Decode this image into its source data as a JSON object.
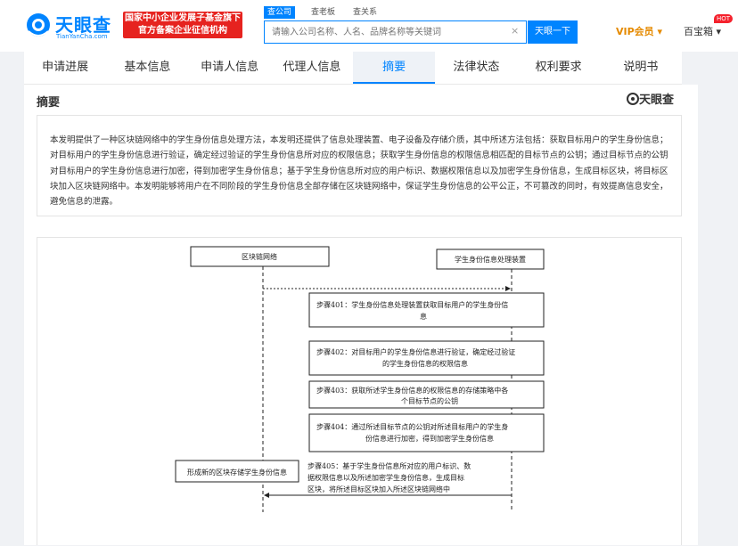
{
  "header": {
    "logo_text": "天眼查",
    "logo_sub": "TianYanCha.com",
    "promo_line1": "国家中小企业发展子基金旗下",
    "promo_line2": "官方备案企业征信机构",
    "search_tabs": [
      "查公司",
      "查老板",
      "查关系"
    ],
    "search_placeholder": "请输入公司名称、人名、品牌名称等关键词",
    "search_button": "天眼一下",
    "vip_label": "VIP会员",
    "user_label": "百宝箱",
    "hot_badge": "HOT"
  },
  "tabs": [
    "申请进展",
    "基本信息",
    "申请人信息",
    "代理人信息",
    "摘要",
    "法律状态",
    "权利要求",
    "说明书"
  ],
  "active_tab_index": 4,
  "section": {
    "title": "摘要",
    "watermark": "天眼查"
  },
  "abstract_text": "本发明提供了一种区块链网络中的学生身份信息处理方法，本发明还提供了信息处理装置、电子设备及存储介质，其中所述方法包括：获取目标用户的学生身份信息；对目标用户的学生身份信息进行验证，确定经过验证的学生身份信息所对应的权限信息；获取学生身份信息的权限信息相匹配的目标节点的公钥；通过目标节点的公钥对目标用户的学生身份信息进行加密，得到加密学生身份信息；基于学生身份信息所对应的用户标识、数据权限信息以及加密学生身份信息，生成目标区块，将目标区块加入区块链网络中。本发明能够将用户在不同阶段的学生身份信息全部存储在区块链网络中，保证学生身份信息的公平公正，不可篡改的同时，有效提高信息安全，避免信息的泄露。",
  "figure": {
    "left_actor": "区块链网络",
    "right_actor": "学生身份信息处理装置",
    "steps": [
      [
        "步骤401：学生身份信息处理装置获取目标用户的学生身份信",
        "息"
      ],
      [
        "步骤402：对目标用户的学生身份信息进行验证，确定经过验证",
        "的学生身份信息的权限信息"
      ],
      [
        "步骤403：获取所述学生身份信息的权限信息的存储策略中各",
        "个目标节点的公钥"
      ],
      [
        "步骤404：通过所述目标节点的公钥对所述目标用户的学生身",
        "份信息进行加密，得到加密学生身份信息"
      ]
    ],
    "step5": [
      "步骤405：基于学生身份信息所对应的用户标识、数",
      "据权限信息以及所述加密学生身份信息，生成目标",
      "区块，将所述目标区块加入所述区块链网络中"
    ],
    "left_box": "形成新的区块存储学生身份信息"
  }
}
